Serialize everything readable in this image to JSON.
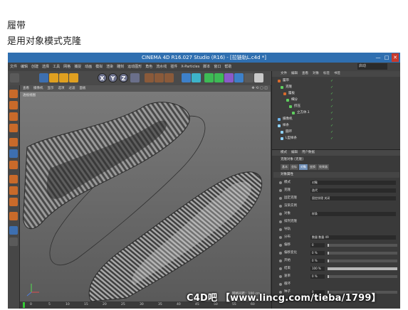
{
  "captions": {
    "line1": "履带",
    "line2": "是用对象模式克隆"
  },
  "window": {
    "title": "CINEMA 4D R16.027 Studio (R16) - [拉链轨L.c4d *]",
    "min": "—",
    "max": "□",
    "close": "✕"
  },
  "menubar": {
    "items": [
      "文件",
      "编辑",
      "创建",
      "选择",
      "工具",
      "网格",
      "捕捉",
      "动画",
      "模拟",
      "渲染",
      "雕刻",
      "运动图形",
      "角色",
      "流水线",
      "插件",
      "X-Particles",
      "脚本",
      "窗口",
      "帮助"
    ],
    "layout_label": "启动"
  },
  "toolbar": {
    "x_axis": "X",
    "y_axis": "Y",
    "z_axis": "Z"
  },
  "viewport": {
    "menu": [
      "查看",
      "摄像机",
      "显示",
      "选项",
      "过滤",
      "面板"
    ],
    "nav_icons": "✥ ⟲ ▢ ◫",
    "label": "透视视图",
    "grid_spacing": "网格间距：100 cm"
  },
  "timeline": {
    "ticks": [
      "0",
      "5",
      "10",
      "15",
      "20",
      "25",
      "30",
      "35",
      "40",
      "45",
      "50",
      "55",
      "60"
    ]
  },
  "object_manager": {
    "menu": [
      "文件",
      "编辑",
      "查看",
      "对象",
      "标签",
      "书签"
    ],
    "objects": [
      {
        "name": "履带",
        "color": "#d96b2d"
      },
      {
        "name": "克隆",
        "color": "#5fcf5f"
      },
      {
        "name": "履板",
        "color": "#d96b2d"
      },
      {
        "name": "细分",
        "color": "#5fcf5f"
      },
      {
        "name": "挤压",
        "color": "#5fcf5f"
      },
      {
        "name": "立方体.1",
        "color": "#5fcf5f"
      },
      {
        "name": "摄像机",
        "color": "#6fb3e8"
      },
      {
        "name": "样条",
        "color": "#8fd3ff"
      },
      {
        "name": "圆环",
        "color": "#8fd3ff"
      },
      {
        "name": "L型样条",
        "color": "#8fd3ff"
      }
    ]
  },
  "attribute_manager": {
    "menu": [
      "模式",
      "编辑",
      "用户数据"
    ],
    "header": "克隆对象 [克隆]",
    "tabs": [
      {
        "label": "基本",
        "active": false
      },
      {
        "label": "坐标",
        "active": false
      },
      {
        "label": "对象",
        "active": true
      },
      {
        "label": "变换",
        "active": false
      },
      {
        "label": "效果器",
        "active": false
      }
    ],
    "section": "对象属性",
    "rows": [
      {
        "label": "模式",
        "value": "对象"
      },
      {
        "label": "克隆",
        "value": "迭代"
      },
      {
        "label": "固定克隆",
        "value": "固定纹理  关闭"
      },
      {
        "label": "渲染实例",
        "value": ""
      },
      {
        "label": "对象",
        "value": "样条"
      },
      {
        "label": "排列克隆",
        "value": ""
      },
      {
        "label": "导轨",
        "value": ""
      },
      {
        "label": "分布",
        "value": "数量   数量  49"
      },
      {
        "label": "偏移",
        "value": "0"
      },
      {
        "label": "偏移变化",
        "value": "0 %"
      },
      {
        "label": "开始",
        "value": "0 %"
      },
      {
        "label": "结束",
        "value": "100 %"
      },
      {
        "label": "速率",
        "value": "0 %"
      },
      {
        "label": "循环",
        "value": ""
      },
      {
        "label": "种子",
        "value": "0"
      }
    ],
    "slider_fill": {
      "start": 0.0,
      "end": 1.0
    }
  },
  "watermark": {
    "text": "C4D吧  【www.lincg.com/tieba/1799】"
  }
}
